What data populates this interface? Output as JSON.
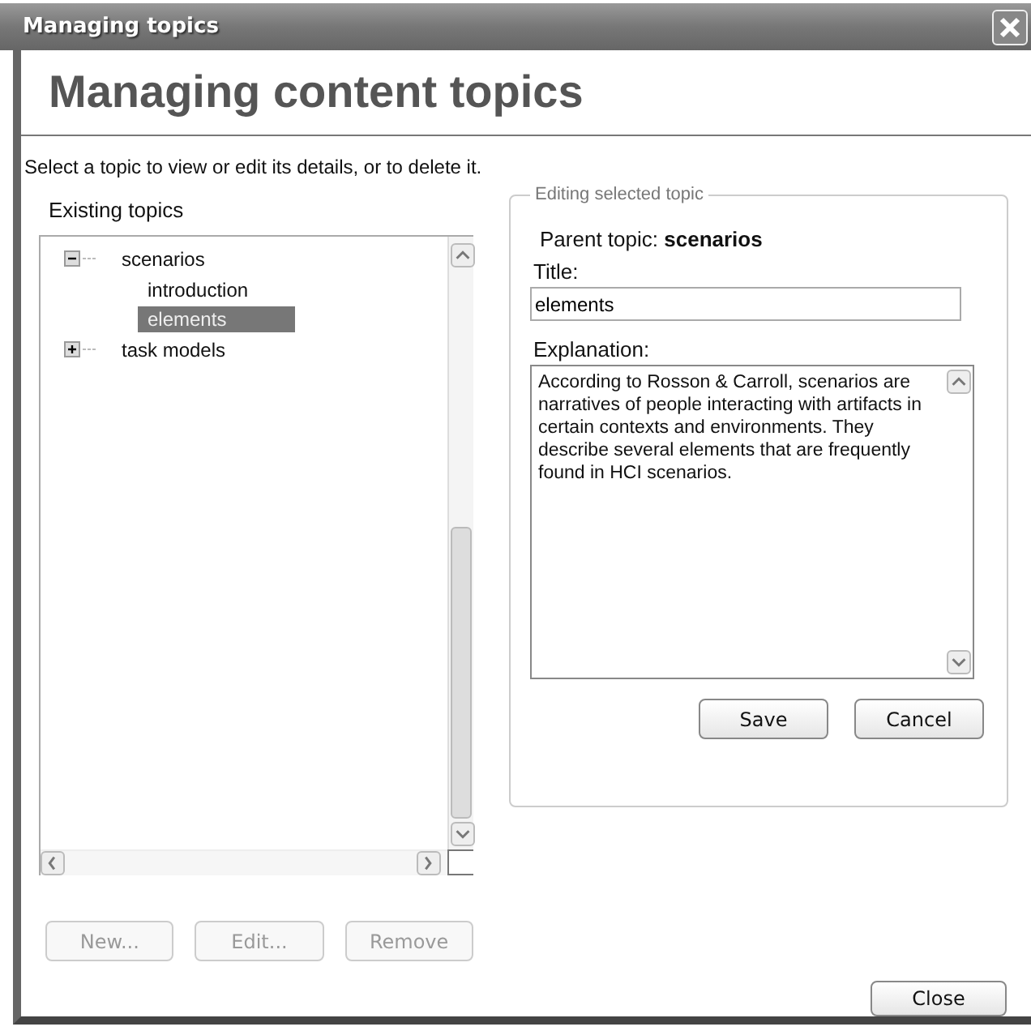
{
  "window": {
    "title": "Managing topics"
  },
  "heading": "Managing content topics",
  "instructions": "Select a topic to view or edit its details, or to delete it.",
  "topics": {
    "label": "Existing topics",
    "tree": [
      {
        "label": "scenarios",
        "expanded": true,
        "selected": false,
        "children": [
          {
            "label": "introduction",
            "selected": false
          },
          {
            "label": "elements",
            "selected": true
          }
        ]
      },
      {
        "label": "task models",
        "expanded": false,
        "selected": false
      }
    ]
  },
  "editor": {
    "legend": "Editing selected topic",
    "parent_label": "Parent topic:",
    "parent_value": "scenarios",
    "title_label": "Title:",
    "title_value": "elements",
    "explanation_label": "Explanation:",
    "explanation_value": "According to Rosson & Carroll, scenarios are narratives of people interacting with artifacts in certain contexts and environments. They describe several elements that are frequently found in HCI scenarios.",
    "buttons": [
      {
        "label": "Save",
        "disabled": false
      },
      {
        "label": "Cancel",
        "disabled": false
      }
    ]
  },
  "list_buttons": [
    {
      "label": "New...",
      "disabled": true
    },
    {
      "label": "Edit...",
      "disabled": true
    },
    {
      "label": "Remove",
      "disabled": true
    }
  ],
  "close_button": {
    "label": "Close",
    "disabled": false
  }
}
